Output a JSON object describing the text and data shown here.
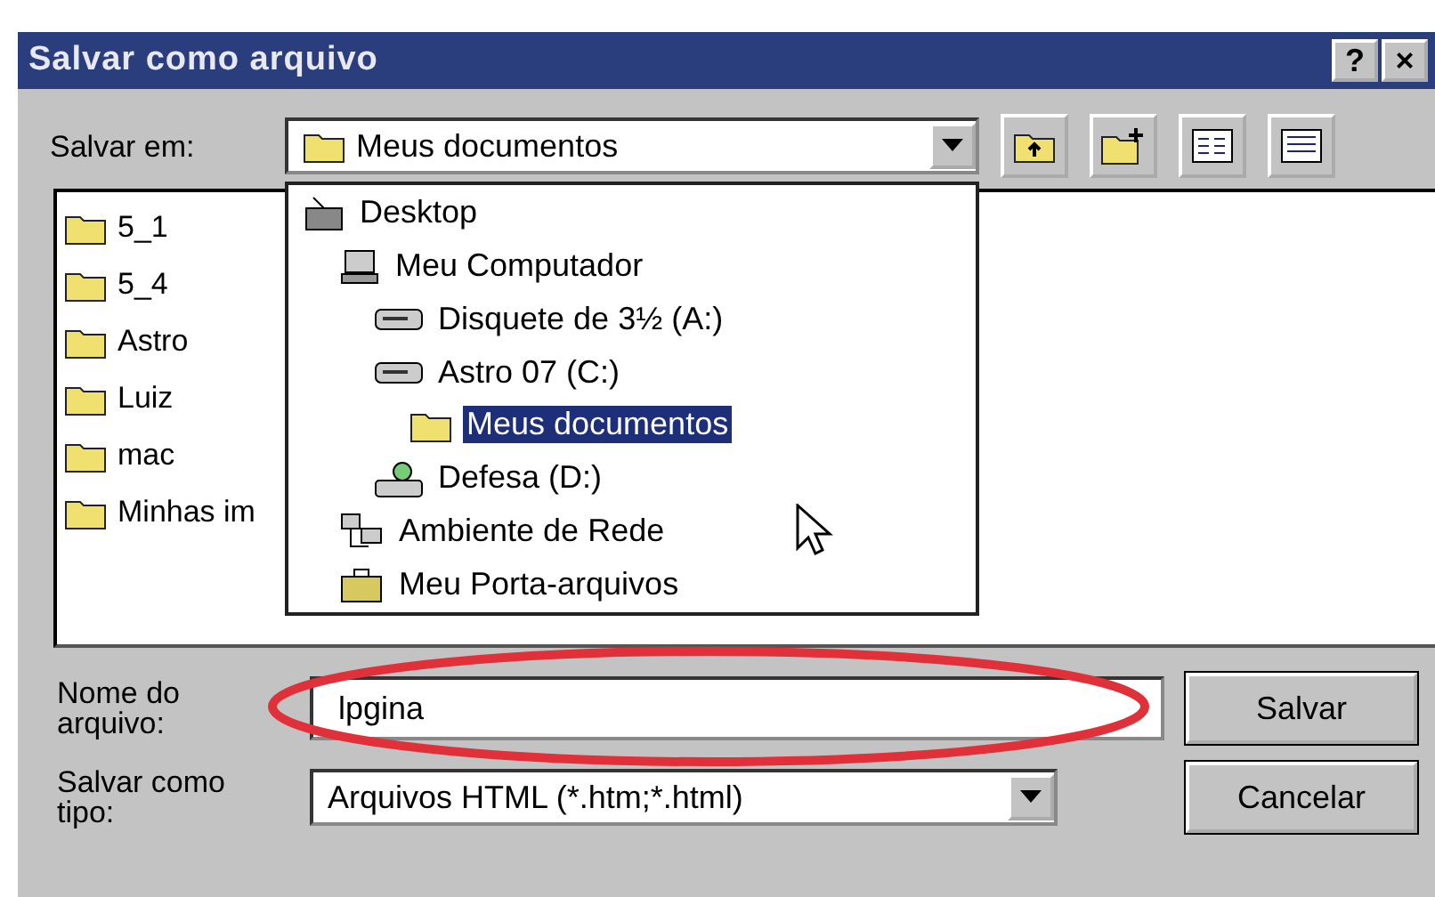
{
  "window": {
    "title": "Salvar como arquivo",
    "title_buttons": [
      "?",
      "×"
    ]
  },
  "save_in": {
    "label": "Salvar em:",
    "value": "Meus documentos"
  },
  "files": [
    {
      "name": "5_1"
    },
    {
      "name": "5_4"
    },
    {
      "name": "Astro"
    },
    {
      "name": "Luiz"
    },
    {
      "name": "mac"
    },
    {
      "name": "Minhas im"
    }
  ],
  "location_dropdown": [
    {
      "label": "Desktop",
      "kind": "desktop",
      "selected": false,
      "children": [
        {
          "label": "Meu Computador",
          "kind": "computer",
          "selected": false,
          "children": [
            {
              "label": "Disquete de 3½ (A:)",
              "kind": "drive",
              "selected": false
            },
            {
              "label": "Astro 07 (C:)",
              "kind": "drive",
              "selected": false,
              "children": [
                {
                  "label": "Meus documentos",
                  "kind": "folder",
                  "selected": true
                }
              ]
            },
            {
              "label": "Defesa (D:)",
              "kind": "cdrom",
              "selected": false
            }
          ]
        },
        {
          "label": "Ambiente de Rede",
          "kind": "network",
          "selected": false
        },
        {
          "label": "Meu Porta-arquivos",
          "kind": "briefcase",
          "selected": false
        }
      ]
    }
  ],
  "file_name": {
    "label": "Nome do arquivo:",
    "value": "lpgina"
  },
  "file_type": {
    "label": "Salvar como tipo:",
    "value": "Arquivos HTML (*.htm;*.html)"
  },
  "buttons": [
    "Salvar",
    "Cancelar"
  ]
}
